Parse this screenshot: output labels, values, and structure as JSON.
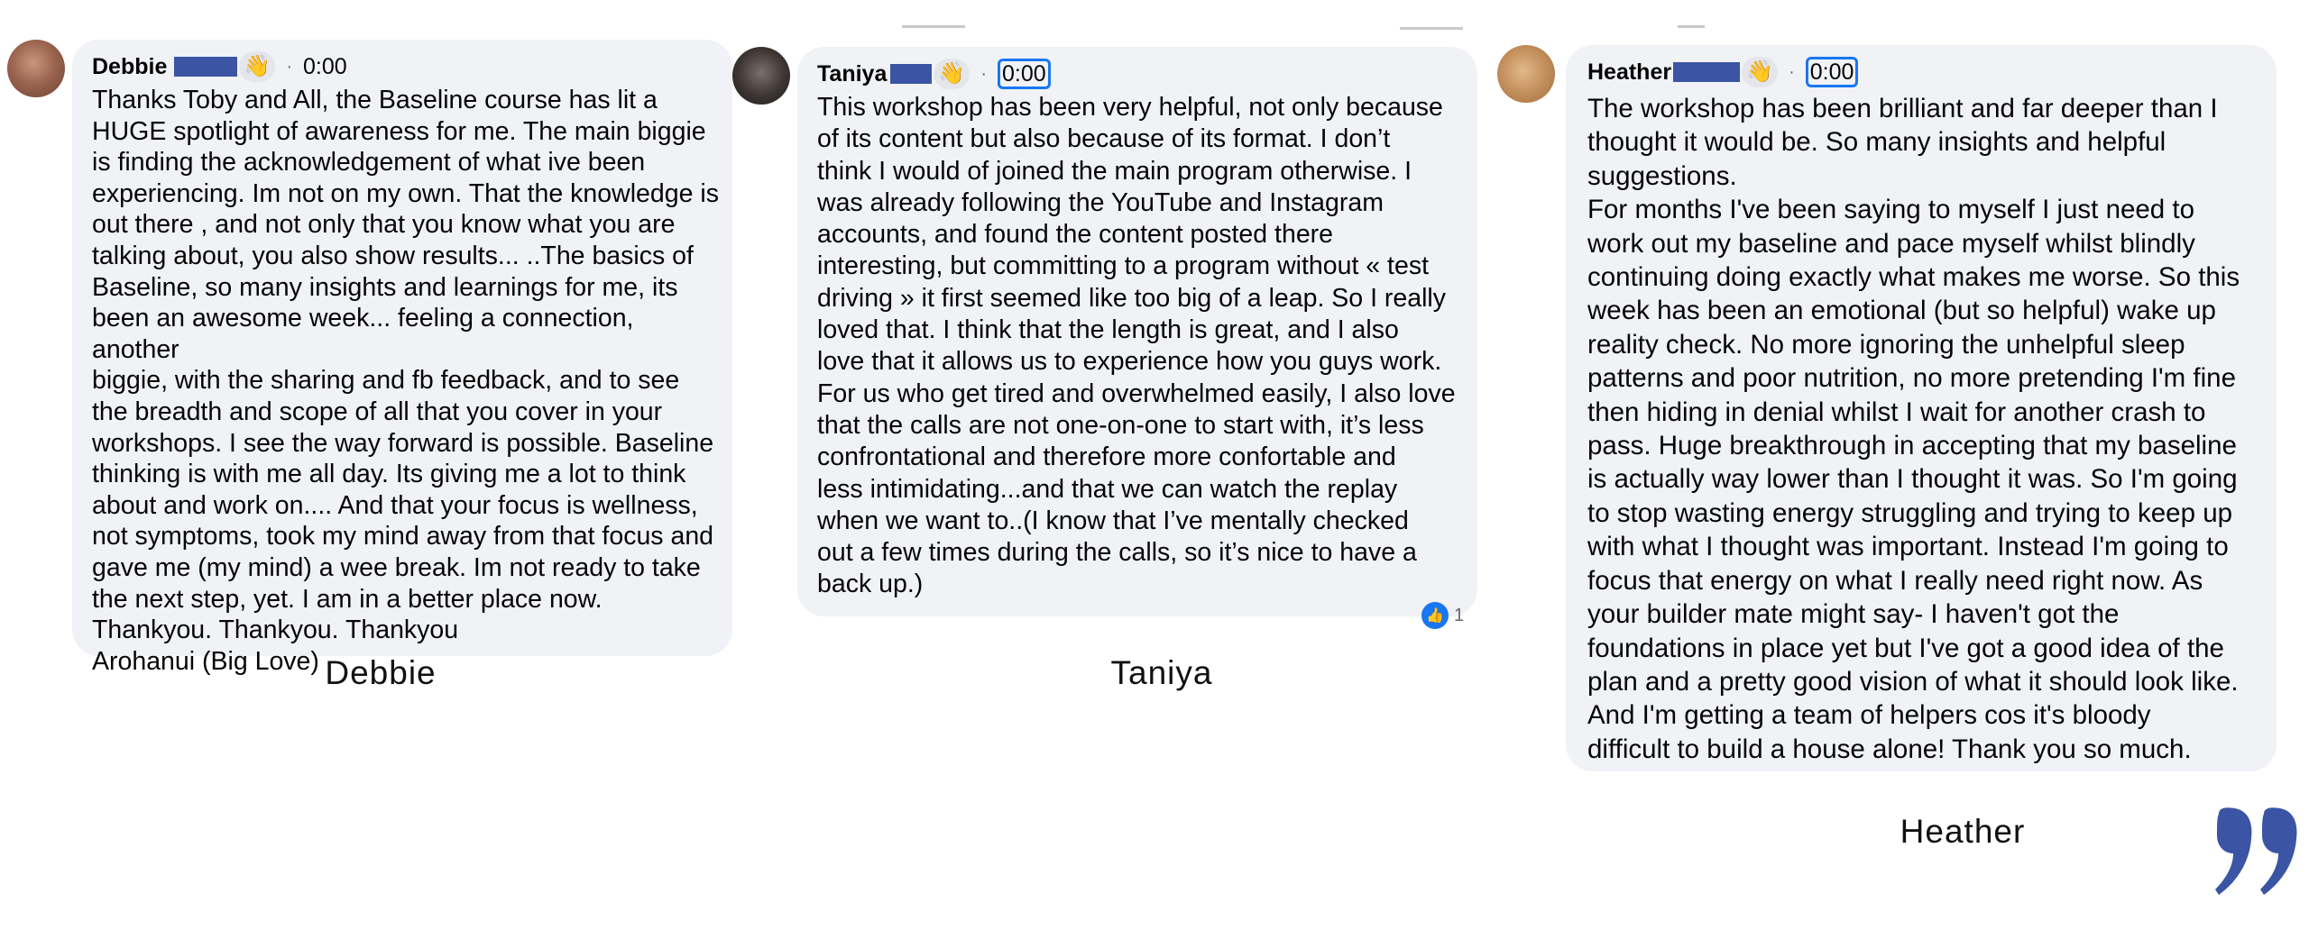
{
  "comments": [
    {
      "name": "Debbie",
      "time": "0:00",
      "text": "Thanks Toby and All, the Baseline course has lit a\nHUGE spotlight of awareness for me. The main biggie\nis finding the acknowledgement of what ive been\nexperiencing. Im not on my own. That the knowledge is\nout there , and not only that you know what you are\ntalking about, you also show results... ..The basics of\nBaseline, so many insights and learnings for me, its\nbeen an awesome week... feeling a connection, another\nbiggie, with the sharing and fb feedback, and to see\nthe breadth and scope of all that you cover in your\nworkshops. I see the way forward is possible. Baseline\nthinking is with me all day. Its giving me a lot to think\nabout and work on.... And that your focus is wellness,\nnot symptoms, took my mind away from that focus and\ngave me (my mind) a wee break. Im not ready to take\nthe next step, yet. I am in a better place now.\nThankyou. Thankyou. Thankyou\nArohanui (Big Love)",
      "caption": "Debbie"
    },
    {
      "name": "Taniya",
      "time": "0:00",
      "text": "This workshop has been very helpful, not only because\nof its content but also because of its format. I don’t\nthink I would of joined the main program otherwise. I\nwas already following the YouTube and Instagram\naccounts, and found the content posted there\ninteresting, but committing to a program without « test\ndriving » it first seemed like too big of a leap. So I really\nloved that. I think that the length is great, and I also\nlove that it allows us to experience how you guys work.\nFor us who get tired and overwhelmed easily, I also love\nthat the calls are not one-on-one to start with, it’s less\nconfrontational and therefore more confortable and\nless intimidating...and that we can watch the replay\nwhen we want to..(I know that I’ve mentally checked\nout a few times during the calls, so it’s nice to have a\nback up.)",
      "caption": "Taniya",
      "reaction_count": "1"
    },
    {
      "name": "Heather",
      "time": "0:00",
      "text": "The workshop has been brilliant and far deeper than I\nthought it would be. So many insights and helpful\nsuggestions.\nFor months I've been saying to myself I just need to\nwork out my baseline and pace myself whilst blindly\ncontinuing doing exactly what makes me worse. So this\nweek has been an emotional (but so helpful) wake up\nreality check. No more ignoring the unhelpful sleep\npatterns and poor nutrition, no more pretending I'm fine\nthen hiding in denial whilst I wait for another crash to\npass. Huge breakthrough in accepting that my baseline\nis actually way lower than I thought it was. So I'm going\nto stop wasting energy struggling and trying to keep up\nwith what I thought was important. Instead I'm going to\nfocus that energy on what I really need right now. As\nyour builder mate might say- I haven't got the\nfoundations in place yet but I've got a good idea of the\nplan and a pretty good vision of what it should look like.\nAnd I'm getting a team of helpers cos it's bloody\ndifficult to build a house alone! Thank you so much.",
      "caption": "Heather"
    }
  ],
  "colors": {
    "bubble": "#f0f2f5",
    "redaction": "#3b55a4",
    "quote_mark": "#3b55a4",
    "time_highlight": "#1877f2"
  },
  "icons": {
    "wave": "waving-hand-icon",
    "like": "like-icon",
    "quote": "quote-mark-icon"
  }
}
